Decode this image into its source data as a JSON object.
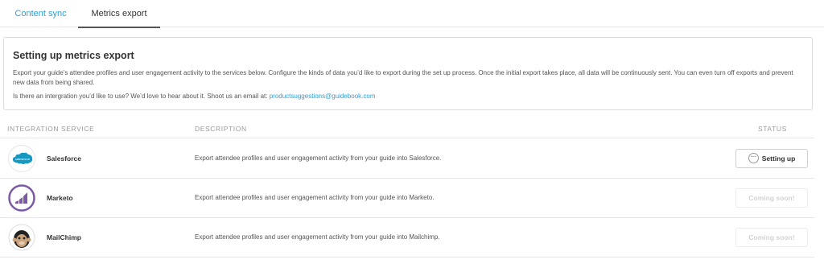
{
  "tabs": [
    {
      "label": "Content sync"
    },
    {
      "label": "Metrics export"
    }
  ],
  "intro": {
    "title": "Setting up metrics export",
    "paragraph": "Export your guide’s attendee profiles and user engagement activity to the services below. Configure the kinds of data you’d like to export during the set up process. Once the initial export takes place, all data will be continuously sent. You can even turn off exports and prevent new data from being shared.",
    "ask_text": "Is there an intergration you’d like to use? We’d love to hear about it. Shoot us an email at: ",
    "email": "productsuggestions@guidebook.com"
  },
  "table": {
    "headers": [
      "INTEGRATION SERVICE",
      "DESCRIPTION",
      "STATUS"
    ],
    "rows": [
      {
        "name": "Salesforce",
        "description": "Export attendee profiles and user engagement activity from your guide into Salesforce.",
        "status": "Setting up",
        "logo_text": "salesforce",
        "icon": "salesforce-logo-icon"
      },
      {
        "name": "Marketo",
        "description": "Export attendee profiles and user engagement activity from your guide into Marketo.",
        "status": "Coming soon!",
        "icon": "marketo-logo-icon"
      },
      {
        "name": "MailChimp",
        "description": "Export attendee profiles and user engagement activity from your guide into Mailchimp.",
        "status": "Coming soon!",
        "icon": "mailchimp-logo-icon"
      }
    ]
  },
  "colors": {
    "accent": "#2a9fd6",
    "salesforce": "#1798c1",
    "marketo": "#7b59a5"
  }
}
